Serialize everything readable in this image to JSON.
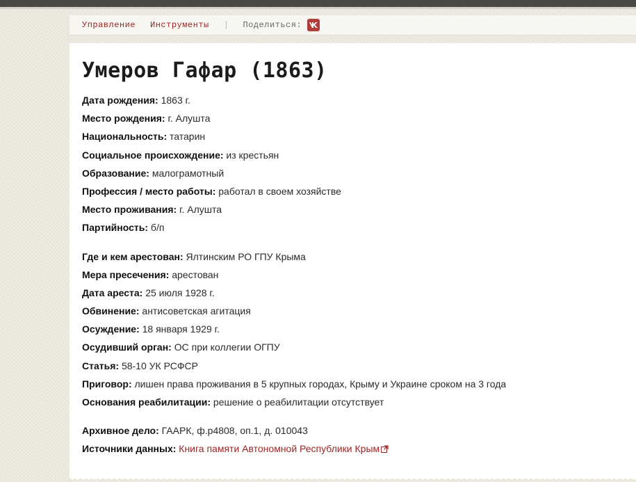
{
  "toolbar": {
    "nav": [
      {
        "label": "Управление"
      },
      {
        "label": "Инструменты"
      }
    ],
    "separator": "|",
    "share_label": "Поделиться:",
    "vk_icon": "vk-icon"
  },
  "colors": {
    "accent": "#9e2424",
    "vk_button": "#b23b3b"
  },
  "title": "Умеров Гафар (1863)",
  "personal": [
    {
      "label": "Дата рождения:",
      "value": "1863 г."
    },
    {
      "label": "Место рождения:",
      "value": "г. Алушта"
    },
    {
      "label": "Национальность:",
      "value": "татарин"
    },
    {
      "label": "Социальное происхождение:",
      "value": "из крестьян"
    },
    {
      "label": "Образование:",
      "value": "малограмотный"
    },
    {
      "label": "Профессия / место работы:",
      "value": "работал в своем хозяйстве"
    },
    {
      "label": "Место проживания:",
      "value": "г. Алушта"
    },
    {
      "label": "Партийность:",
      "value": "б/п"
    }
  ],
  "arrest": [
    {
      "label": "Где и кем арестован:",
      "value": "Ялтинским РО ГПУ Крыма"
    },
    {
      "label": "Мера пресечения:",
      "value": "арестован"
    },
    {
      "label": "Дата ареста:",
      "value": "25 июля 1928 г."
    },
    {
      "label": "Обвинение:",
      "value": "антисоветская агитация"
    },
    {
      "label": "Осуждение:",
      "value": "18 января 1929 г."
    },
    {
      "label": "Осудивший орган:",
      "value": "ОС при коллегии ОГПУ"
    },
    {
      "label": "Статья:",
      "value": "58-10 УК РСФСР"
    },
    {
      "label": "Приговор:",
      "value": "лишен права проживания в 5 крупных городах, Крыму и Украине сроком на 3 года"
    },
    {
      "label": "Основания реабилитации:",
      "value": "решение о реабилитации отсутствует"
    }
  ],
  "archive": {
    "case_label": "Архивное дело:",
    "case_value": "ГААРК, ф.р4808, оп.1, д. 010043",
    "sources_label": "Источники данных:",
    "sources_link": "Книга памяти Автономной Республики Крым",
    "external_icon": "external-link-icon"
  }
}
